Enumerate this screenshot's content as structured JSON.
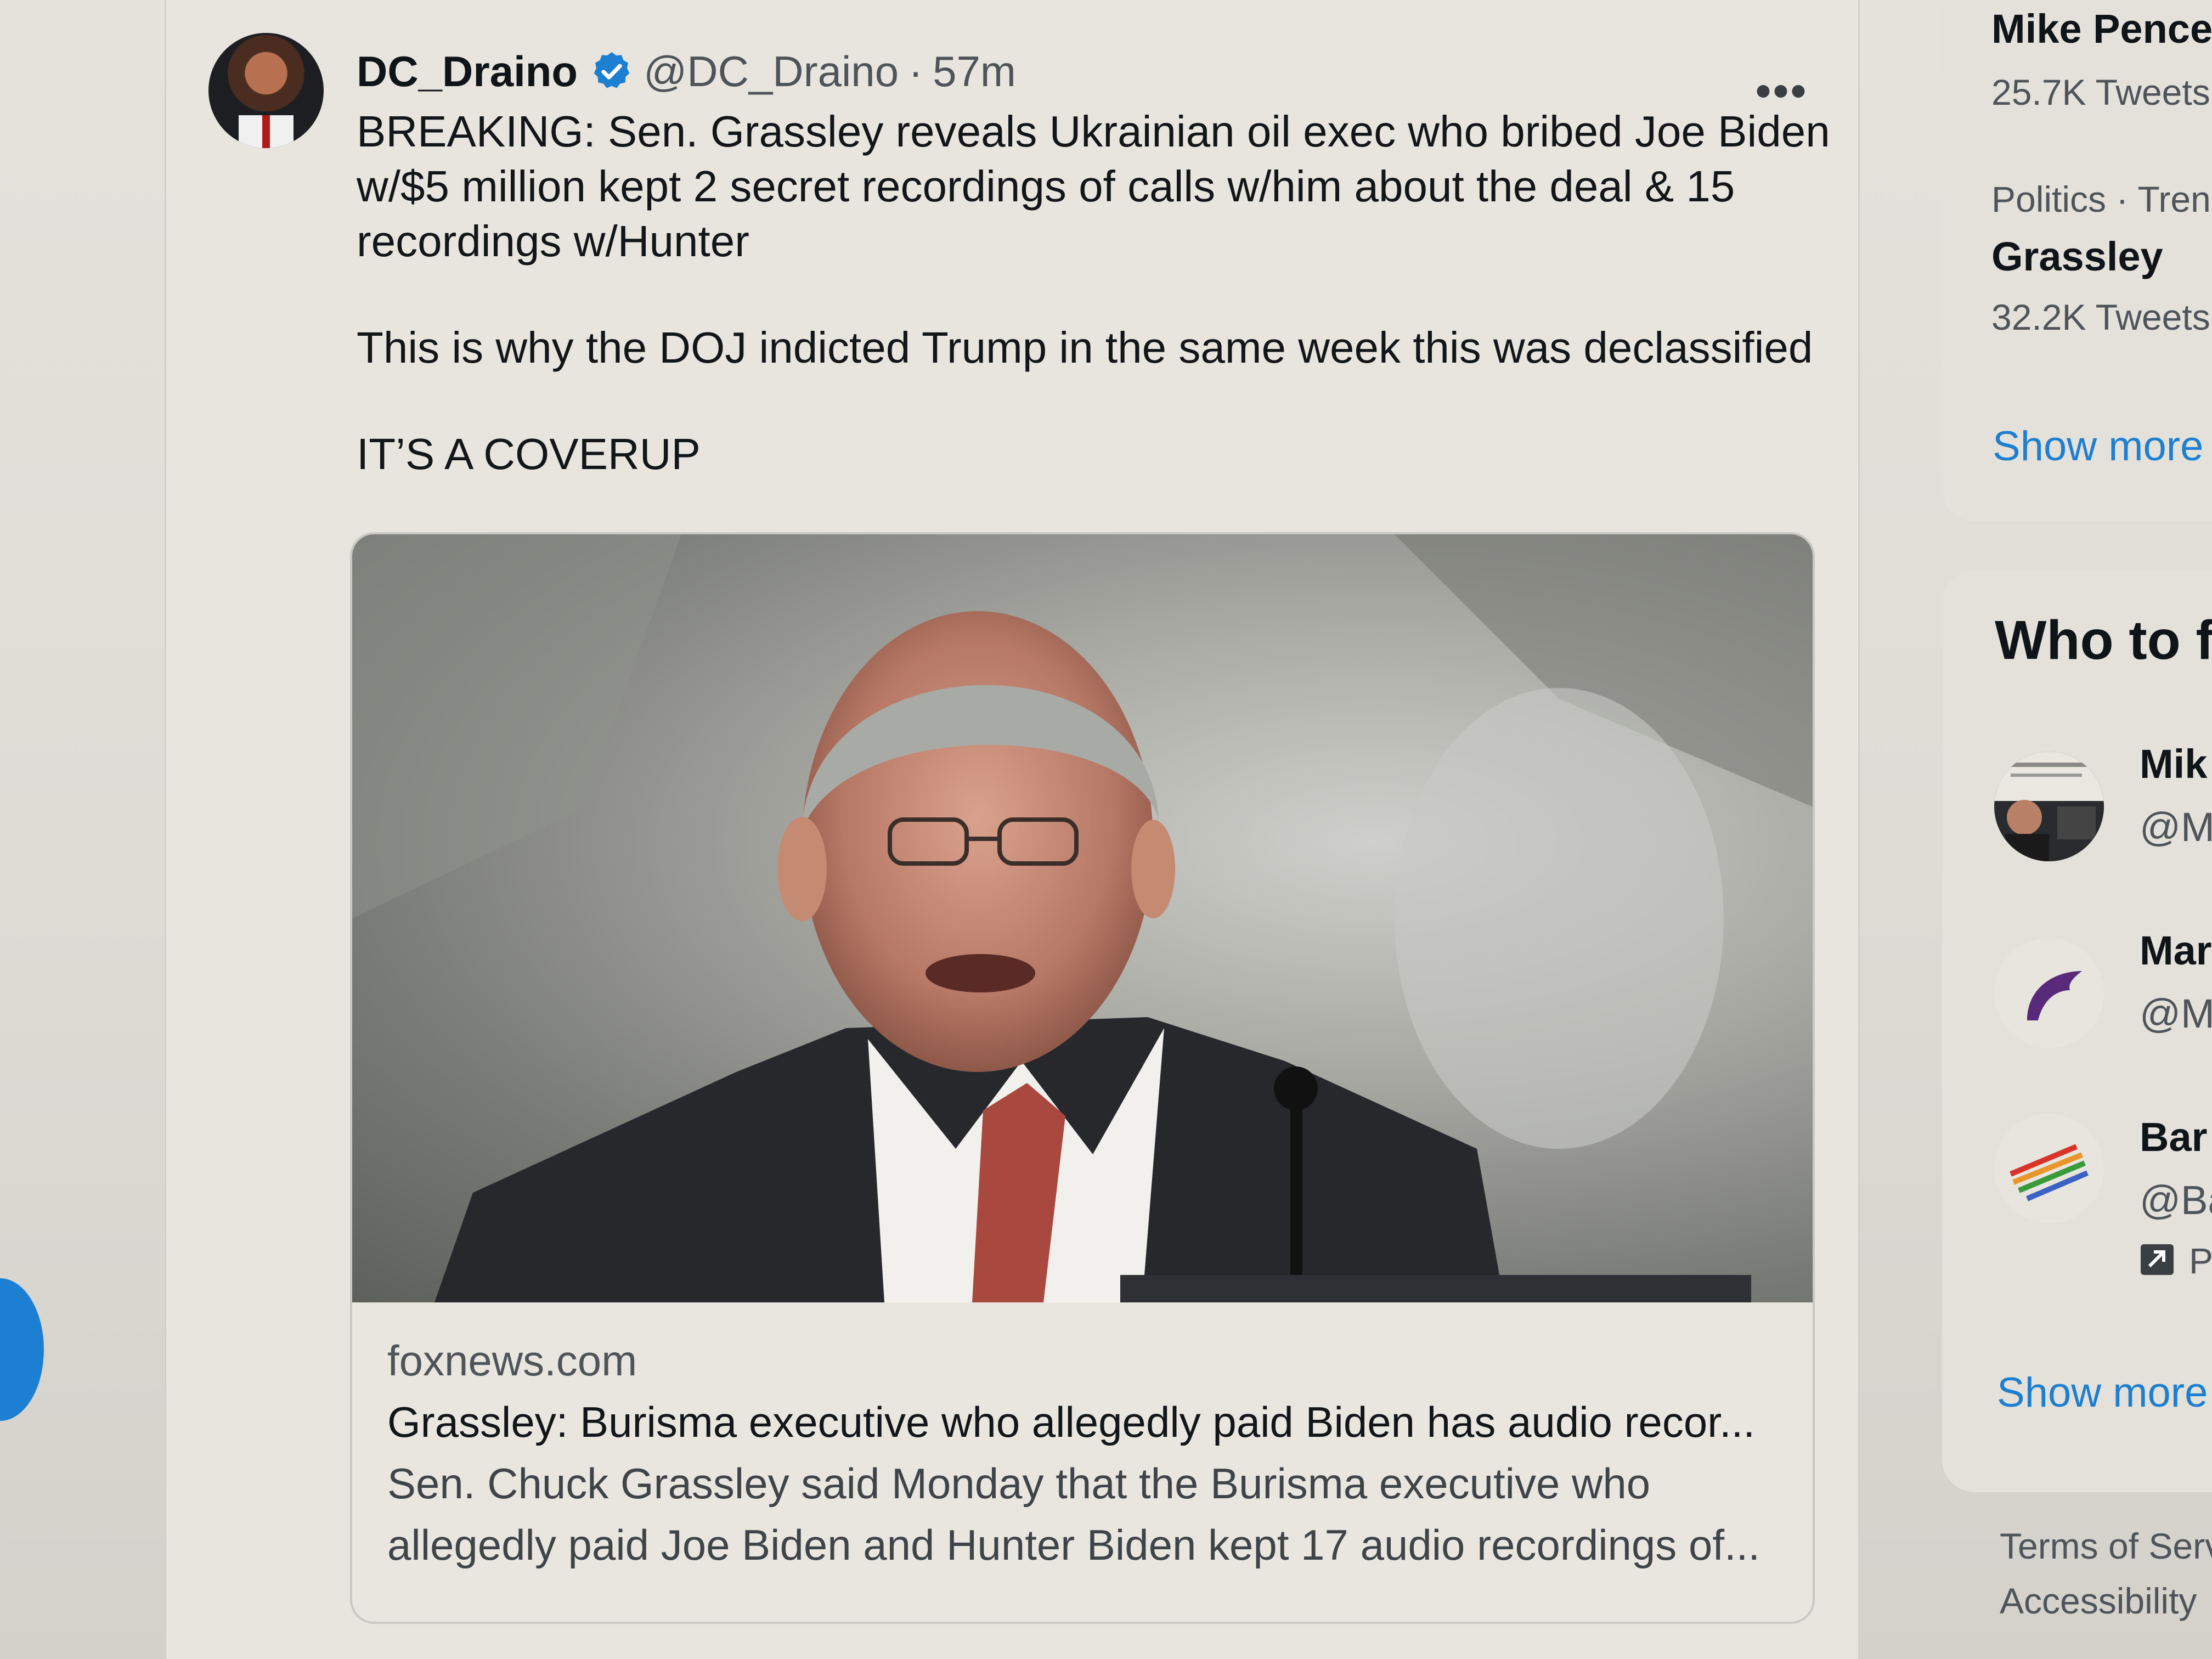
{
  "tweet": {
    "display_name": "DC_Draino",
    "handle": "@DC_Draino",
    "separator": "·",
    "time": "57m",
    "more": "•••",
    "paragraphs": [
      "BREAKING: Sen. Grassley reveals Ukrainian oil exec who bribed Joe Biden w/$5 million kept 2 secret recordings of calls w/him about the deal & 15 recordings w/Hunter",
      "This is why the DOJ indicted Trump in the same week this was declassified",
      "IT’S A COVERUP"
    ],
    "card": {
      "domain": "foxnews.com",
      "title": "Grassley: Burisma executive who allegedly paid Biden has audio recor...",
      "description_line1": "Sen. Chuck Grassley said Monday that the Burisma executive who",
      "description_line2": "allegedly paid Joe Biden and Hunter Biden kept 17 audio recordings of..."
    }
  },
  "sidebar": {
    "trends": [
      {
        "name": "Mike Pence",
        "count": "25.7K Tweets"
      },
      {
        "category": "Politics · Tren",
        "name": "Grassley",
        "count": "32.2K Tweets"
      }
    ],
    "trends_show_more": "Show more",
    "who_to_follow": {
      "title": "Who to f",
      "items": [
        {
          "name": "Mik",
          "handle": "@M"
        },
        {
          "name": "Mar",
          "handle": "@M"
        },
        {
          "name": "Bar",
          "handle": "@Ba",
          "promoted": "P"
        }
      ],
      "show_more": "Show more"
    },
    "footer": {
      "terms": "Terms of Serv",
      "accessibility": "Accessibility"
    }
  },
  "colors": {
    "accent": "#1d7fd1",
    "text": "#121619",
    "muted": "#4e5459"
  }
}
